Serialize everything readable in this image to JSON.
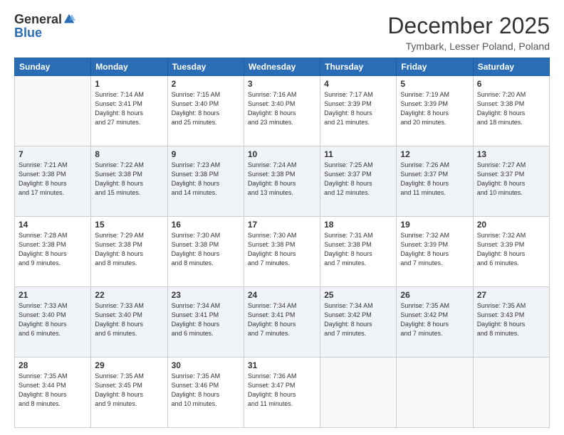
{
  "logo": {
    "general": "General",
    "blue": "Blue"
  },
  "header": {
    "month": "December 2025",
    "location": "Tymbark, Lesser Poland, Poland"
  },
  "weekdays": [
    "Sunday",
    "Monday",
    "Tuesday",
    "Wednesday",
    "Thursday",
    "Friday",
    "Saturday"
  ],
  "weeks": [
    [
      {
        "day": "",
        "info": ""
      },
      {
        "day": "1",
        "info": "Sunrise: 7:14 AM\nSunset: 3:41 PM\nDaylight: 8 hours\nand 27 minutes."
      },
      {
        "day": "2",
        "info": "Sunrise: 7:15 AM\nSunset: 3:40 PM\nDaylight: 8 hours\nand 25 minutes."
      },
      {
        "day": "3",
        "info": "Sunrise: 7:16 AM\nSunset: 3:40 PM\nDaylight: 8 hours\nand 23 minutes."
      },
      {
        "day": "4",
        "info": "Sunrise: 7:17 AM\nSunset: 3:39 PM\nDaylight: 8 hours\nand 21 minutes."
      },
      {
        "day": "5",
        "info": "Sunrise: 7:19 AM\nSunset: 3:39 PM\nDaylight: 8 hours\nand 20 minutes."
      },
      {
        "day": "6",
        "info": "Sunrise: 7:20 AM\nSunset: 3:38 PM\nDaylight: 8 hours\nand 18 minutes."
      }
    ],
    [
      {
        "day": "7",
        "info": "Sunrise: 7:21 AM\nSunset: 3:38 PM\nDaylight: 8 hours\nand 17 minutes."
      },
      {
        "day": "8",
        "info": "Sunrise: 7:22 AM\nSunset: 3:38 PM\nDaylight: 8 hours\nand 15 minutes."
      },
      {
        "day": "9",
        "info": "Sunrise: 7:23 AM\nSunset: 3:38 PM\nDaylight: 8 hours\nand 14 minutes."
      },
      {
        "day": "10",
        "info": "Sunrise: 7:24 AM\nSunset: 3:38 PM\nDaylight: 8 hours\nand 13 minutes."
      },
      {
        "day": "11",
        "info": "Sunrise: 7:25 AM\nSunset: 3:37 PM\nDaylight: 8 hours\nand 12 minutes."
      },
      {
        "day": "12",
        "info": "Sunrise: 7:26 AM\nSunset: 3:37 PM\nDaylight: 8 hours\nand 11 minutes."
      },
      {
        "day": "13",
        "info": "Sunrise: 7:27 AM\nSunset: 3:37 PM\nDaylight: 8 hours\nand 10 minutes."
      }
    ],
    [
      {
        "day": "14",
        "info": "Sunrise: 7:28 AM\nSunset: 3:38 PM\nDaylight: 8 hours\nand 9 minutes."
      },
      {
        "day": "15",
        "info": "Sunrise: 7:29 AM\nSunset: 3:38 PM\nDaylight: 8 hours\nand 8 minutes."
      },
      {
        "day": "16",
        "info": "Sunrise: 7:30 AM\nSunset: 3:38 PM\nDaylight: 8 hours\nand 8 minutes."
      },
      {
        "day": "17",
        "info": "Sunrise: 7:30 AM\nSunset: 3:38 PM\nDaylight: 8 hours\nand 7 minutes."
      },
      {
        "day": "18",
        "info": "Sunrise: 7:31 AM\nSunset: 3:38 PM\nDaylight: 8 hours\nand 7 minutes."
      },
      {
        "day": "19",
        "info": "Sunrise: 7:32 AM\nSunset: 3:39 PM\nDaylight: 8 hours\nand 7 minutes."
      },
      {
        "day": "20",
        "info": "Sunrise: 7:32 AM\nSunset: 3:39 PM\nDaylight: 8 hours\nand 6 minutes."
      }
    ],
    [
      {
        "day": "21",
        "info": "Sunrise: 7:33 AM\nSunset: 3:40 PM\nDaylight: 8 hours\nand 6 minutes."
      },
      {
        "day": "22",
        "info": "Sunrise: 7:33 AM\nSunset: 3:40 PM\nDaylight: 8 hours\nand 6 minutes."
      },
      {
        "day": "23",
        "info": "Sunrise: 7:34 AM\nSunset: 3:41 PM\nDaylight: 8 hours\nand 6 minutes."
      },
      {
        "day": "24",
        "info": "Sunrise: 7:34 AM\nSunset: 3:41 PM\nDaylight: 8 hours\nand 7 minutes."
      },
      {
        "day": "25",
        "info": "Sunrise: 7:34 AM\nSunset: 3:42 PM\nDaylight: 8 hours\nand 7 minutes."
      },
      {
        "day": "26",
        "info": "Sunrise: 7:35 AM\nSunset: 3:42 PM\nDaylight: 8 hours\nand 7 minutes."
      },
      {
        "day": "27",
        "info": "Sunrise: 7:35 AM\nSunset: 3:43 PM\nDaylight: 8 hours\nand 8 minutes."
      }
    ],
    [
      {
        "day": "28",
        "info": "Sunrise: 7:35 AM\nSunset: 3:44 PM\nDaylight: 8 hours\nand 8 minutes."
      },
      {
        "day": "29",
        "info": "Sunrise: 7:35 AM\nSunset: 3:45 PM\nDaylight: 8 hours\nand 9 minutes."
      },
      {
        "day": "30",
        "info": "Sunrise: 7:35 AM\nSunset: 3:46 PM\nDaylight: 8 hours\nand 10 minutes."
      },
      {
        "day": "31",
        "info": "Sunrise: 7:36 AM\nSunset: 3:47 PM\nDaylight: 8 hours\nand 11 minutes."
      },
      {
        "day": "",
        "info": ""
      },
      {
        "day": "",
        "info": ""
      },
      {
        "day": "",
        "info": ""
      }
    ]
  ]
}
